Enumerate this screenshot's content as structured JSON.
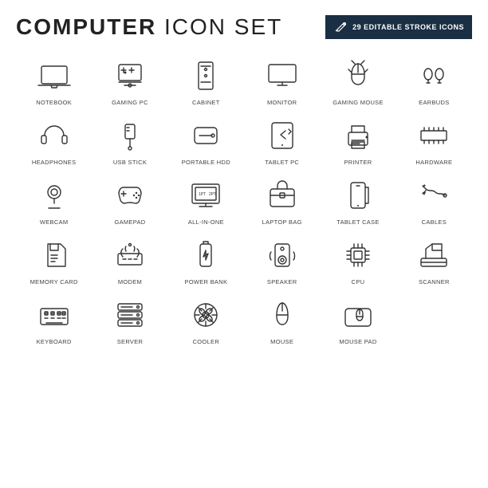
{
  "header": {
    "title_prefix": "COMPUTER",
    "title_suffix": " ICON SET",
    "badge_line1": "29 EDITABLE STROKE ICONS"
  },
  "icons": [
    {
      "id": "notebook",
      "label": "NOTEBOOK"
    },
    {
      "id": "gaming-pc",
      "label": "GAMING PC"
    },
    {
      "id": "cabinet",
      "label": "CABINET"
    },
    {
      "id": "monitor",
      "label": "MONITOR"
    },
    {
      "id": "gaming-mouse",
      "label": "GAMING MOUSE"
    },
    {
      "id": "earbuds",
      "label": "EARBUDS"
    },
    {
      "id": "headphones",
      "label": "HEADPHONES"
    },
    {
      "id": "usb-stick",
      "label": "USB STICK"
    },
    {
      "id": "portable-hdd",
      "label": "PORTABLE HDD"
    },
    {
      "id": "tablet-pc",
      "label": "TABLET PC"
    },
    {
      "id": "printer",
      "label": "PRINTER"
    },
    {
      "id": "hardware",
      "label": "HARDWARE"
    },
    {
      "id": "webcam",
      "label": "WEBCAM"
    },
    {
      "id": "gamepad",
      "label": "GAMEPAD"
    },
    {
      "id": "all-in-one",
      "label": "ALL-IN-ONE"
    },
    {
      "id": "laptop-bag",
      "label": "LAPTOP BAG"
    },
    {
      "id": "tablet-case",
      "label": "TABLET CASE"
    },
    {
      "id": "cables",
      "label": "CABLES"
    },
    {
      "id": "memory-card",
      "label": "MEMORY CARD"
    },
    {
      "id": "modem",
      "label": "MODEM"
    },
    {
      "id": "power-bank",
      "label": "POWER BANK"
    },
    {
      "id": "speaker",
      "label": "SPEAKER"
    },
    {
      "id": "cpu",
      "label": "CPU"
    },
    {
      "id": "scanner",
      "label": "SCANNER"
    },
    {
      "id": "keyboard",
      "label": "KEYBOARD"
    },
    {
      "id": "server",
      "label": "SERVER"
    },
    {
      "id": "cooler",
      "label": "COOLER"
    },
    {
      "id": "mouse",
      "label": "MOUSE"
    },
    {
      "id": "mouse-pad",
      "label": "MOUSE PAD"
    }
  ]
}
